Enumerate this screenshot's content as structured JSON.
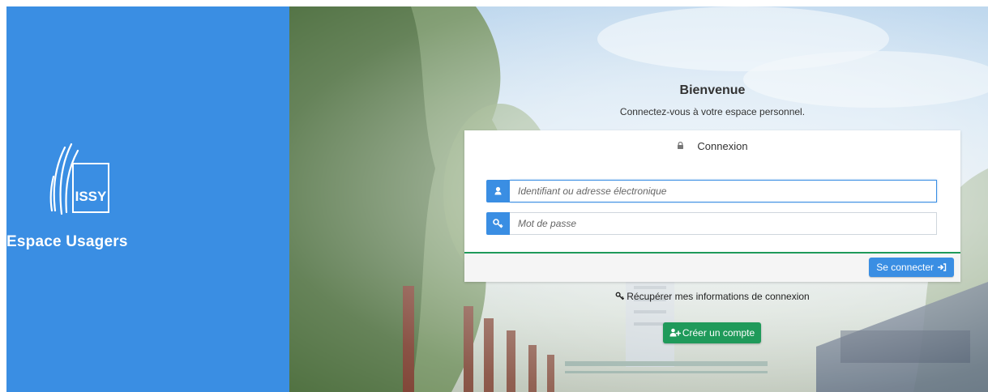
{
  "brand": {
    "logo_text": "ISSY",
    "title": "Espace Usagers"
  },
  "welcome": {
    "title": "Bienvenue",
    "subtitle": "Connectez-vous à votre espace personnel."
  },
  "login_card": {
    "header": "Connexion",
    "username": {
      "value": "",
      "placeholder": "Identifiant ou adresse électronique"
    },
    "password": {
      "value": "",
      "placeholder": "Mot de passe"
    },
    "submit_label": "Se connecter"
  },
  "recover_link": "Récupérer mes informations de connexion",
  "create_account_label": "Créer un compte",
  "icons": {
    "logo": "issy-logo",
    "lock": "lock-icon",
    "user": "user-icon",
    "key": "key-icon",
    "sign_in": "sign-in-icon",
    "user_plus": "user-plus-icon"
  },
  "colors": {
    "primary": "#3a8ee3",
    "success": "#1f9a5a",
    "text": "#333333"
  }
}
